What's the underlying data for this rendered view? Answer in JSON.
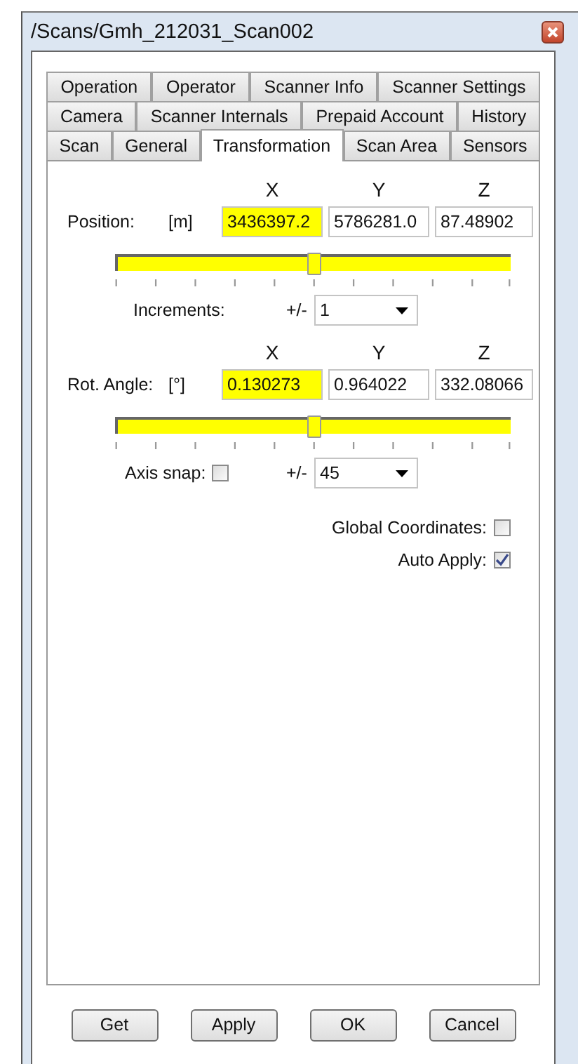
{
  "window": {
    "title": "/Scans/Gmh_212031_Scan002"
  },
  "tab_rows": [
    [
      {
        "label": "Operation",
        "selected": false
      },
      {
        "label": "Operator",
        "selected": false
      },
      {
        "label": "Scanner Info",
        "selected": false
      },
      {
        "label": "Scanner Settings",
        "selected": false
      }
    ],
    [
      {
        "label": "Camera",
        "selected": false
      },
      {
        "label": "Scanner Internals",
        "selected": false
      },
      {
        "label": "Prepaid Account",
        "selected": false
      },
      {
        "label": "History",
        "selected": false
      }
    ],
    [
      {
        "label": "Scan",
        "selected": false
      },
      {
        "label": "General",
        "selected": false
      },
      {
        "label": "Transformation",
        "selected": true
      },
      {
        "label": "Scan Area",
        "selected": false
      },
      {
        "label": "Sensors",
        "selected": false
      }
    ]
  ],
  "sections": [
    {
      "kind": "position",
      "label": "Position:",
      "unit": "[m]",
      "axes": [
        "X",
        "Y",
        "Z"
      ],
      "fields": [
        {
          "value": "3436397.2",
          "highlighted": true
        },
        {
          "value": "5786281.0",
          "highlighted": false
        },
        {
          "value": "87.48902",
          "highlighted": false
        }
      ],
      "slider": {
        "level": 0.5
      },
      "increments": {
        "label": "Increments:",
        "prefix": "+/-",
        "value": "1"
      }
    },
    {
      "kind": "rotation",
      "label": "Rot. Angle:",
      "unit": "[°]",
      "axes": [
        "X",
        "Y",
        "Z"
      ],
      "fields": [
        {
          "value": "0.130273",
          "highlighted": true
        },
        {
          "value": "0.964022",
          "highlighted": false
        },
        {
          "value": "332.08066",
          "highlighted": false
        }
      ],
      "slider": {
        "level": 0.5
      },
      "axis_snap": {
        "label": "Axis snap:",
        "checked": false
      },
      "increments": {
        "prefix": "+/-",
        "value": "45"
      }
    }
  ],
  "options": [
    {
      "label": "Global Coordinates:",
      "checked": false
    },
    {
      "label": "Auto Apply:",
      "checked": true
    }
  ],
  "buttons": [
    "Get",
    "Apply",
    "OK",
    "Cancel"
  ]
}
